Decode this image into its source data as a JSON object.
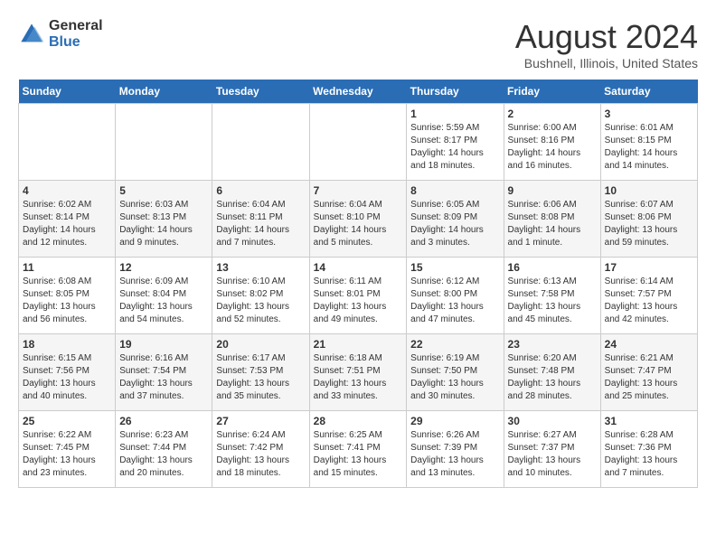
{
  "logo": {
    "general": "General",
    "blue": "Blue"
  },
  "title": {
    "month": "August 2024",
    "location": "Bushnell, Illinois, United States"
  },
  "weekdays": [
    "Sunday",
    "Monday",
    "Tuesday",
    "Wednesday",
    "Thursday",
    "Friday",
    "Saturday"
  ],
  "weeks": [
    [
      {
        "day": "",
        "info": ""
      },
      {
        "day": "",
        "info": ""
      },
      {
        "day": "",
        "info": ""
      },
      {
        "day": "",
        "info": ""
      },
      {
        "day": "1",
        "info": "Sunrise: 5:59 AM\nSunset: 8:17 PM\nDaylight: 14 hours\nand 18 minutes."
      },
      {
        "day": "2",
        "info": "Sunrise: 6:00 AM\nSunset: 8:16 PM\nDaylight: 14 hours\nand 16 minutes."
      },
      {
        "day": "3",
        "info": "Sunrise: 6:01 AM\nSunset: 8:15 PM\nDaylight: 14 hours\nand 14 minutes."
      }
    ],
    [
      {
        "day": "4",
        "info": "Sunrise: 6:02 AM\nSunset: 8:14 PM\nDaylight: 14 hours\nand 12 minutes."
      },
      {
        "day": "5",
        "info": "Sunrise: 6:03 AM\nSunset: 8:13 PM\nDaylight: 14 hours\nand 9 minutes."
      },
      {
        "day": "6",
        "info": "Sunrise: 6:04 AM\nSunset: 8:11 PM\nDaylight: 14 hours\nand 7 minutes."
      },
      {
        "day": "7",
        "info": "Sunrise: 6:04 AM\nSunset: 8:10 PM\nDaylight: 14 hours\nand 5 minutes."
      },
      {
        "day": "8",
        "info": "Sunrise: 6:05 AM\nSunset: 8:09 PM\nDaylight: 14 hours\nand 3 minutes."
      },
      {
        "day": "9",
        "info": "Sunrise: 6:06 AM\nSunset: 8:08 PM\nDaylight: 14 hours\nand 1 minute."
      },
      {
        "day": "10",
        "info": "Sunrise: 6:07 AM\nSunset: 8:06 PM\nDaylight: 13 hours\nand 59 minutes."
      }
    ],
    [
      {
        "day": "11",
        "info": "Sunrise: 6:08 AM\nSunset: 8:05 PM\nDaylight: 13 hours\nand 56 minutes."
      },
      {
        "day": "12",
        "info": "Sunrise: 6:09 AM\nSunset: 8:04 PM\nDaylight: 13 hours\nand 54 minutes."
      },
      {
        "day": "13",
        "info": "Sunrise: 6:10 AM\nSunset: 8:02 PM\nDaylight: 13 hours\nand 52 minutes."
      },
      {
        "day": "14",
        "info": "Sunrise: 6:11 AM\nSunset: 8:01 PM\nDaylight: 13 hours\nand 49 minutes."
      },
      {
        "day": "15",
        "info": "Sunrise: 6:12 AM\nSunset: 8:00 PM\nDaylight: 13 hours\nand 47 minutes."
      },
      {
        "day": "16",
        "info": "Sunrise: 6:13 AM\nSunset: 7:58 PM\nDaylight: 13 hours\nand 45 minutes."
      },
      {
        "day": "17",
        "info": "Sunrise: 6:14 AM\nSunset: 7:57 PM\nDaylight: 13 hours\nand 42 minutes."
      }
    ],
    [
      {
        "day": "18",
        "info": "Sunrise: 6:15 AM\nSunset: 7:56 PM\nDaylight: 13 hours\nand 40 minutes."
      },
      {
        "day": "19",
        "info": "Sunrise: 6:16 AM\nSunset: 7:54 PM\nDaylight: 13 hours\nand 37 minutes."
      },
      {
        "day": "20",
        "info": "Sunrise: 6:17 AM\nSunset: 7:53 PM\nDaylight: 13 hours\nand 35 minutes."
      },
      {
        "day": "21",
        "info": "Sunrise: 6:18 AM\nSunset: 7:51 PM\nDaylight: 13 hours\nand 33 minutes."
      },
      {
        "day": "22",
        "info": "Sunrise: 6:19 AM\nSunset: 7:50 PM\nDaylight: 13 hours\nand 30 minutes."
      },
      {
        "day": "23",
        "info": "Sunrise: 6:20 AM\nSunset: 7:48 PM\nDaylight: 13 hours\nand 28 minutes."
      },
      {
        "day": "24",
        "info": "Sunrise: 6:21 AM\nSunset: 7:47 PM\nDaylight: 13 hours\nand 25 minutes."
      }
    ],
    [
      {
        "day": "25",
        "info": "Sunrise: 6:22 AM\nSunset: 7:45 PM\nDaylight: 13 hours\nand 23 minutes."
      },
      {
        "day": "26",
        "info": "Sunrise: 6:23 AM\nSunset: 7:44 PM\nDaylight: 13 hours\nand 20 minutes."
      },
      {
        "day": "27",
        "info": "Sunrise: 6:24 AM\nSunset: 7:42 PM\nDaylight: 13 hours\nand 18 minutes."
      },
      {
        "day": "28",
        "info": "Sunrise: 6:25 AM\nSunset: 7:41 PM\nDaylight: 13 hours\nand 15 minutes."
      },
      {
        "day": "29",
        "info": "Sunrise: 6:26 AM\nSunset: 7:39 PM\nDaylight: 13 hours\nand 13 minutes."
      },
      {
        "day": "30",
        "info": "Sunrise: 6:27 AM\nSunset: 7:37 PM\nDaylight: 13 hours\nand 10 minutes."
      },
      {
        "day": "31",
        "info": "Sunrise: 6:28 AM\nSunset: 7:36 PM\nDaylight: 13 hours\nand 7 minutes."
      }
    ]
  ]
}
